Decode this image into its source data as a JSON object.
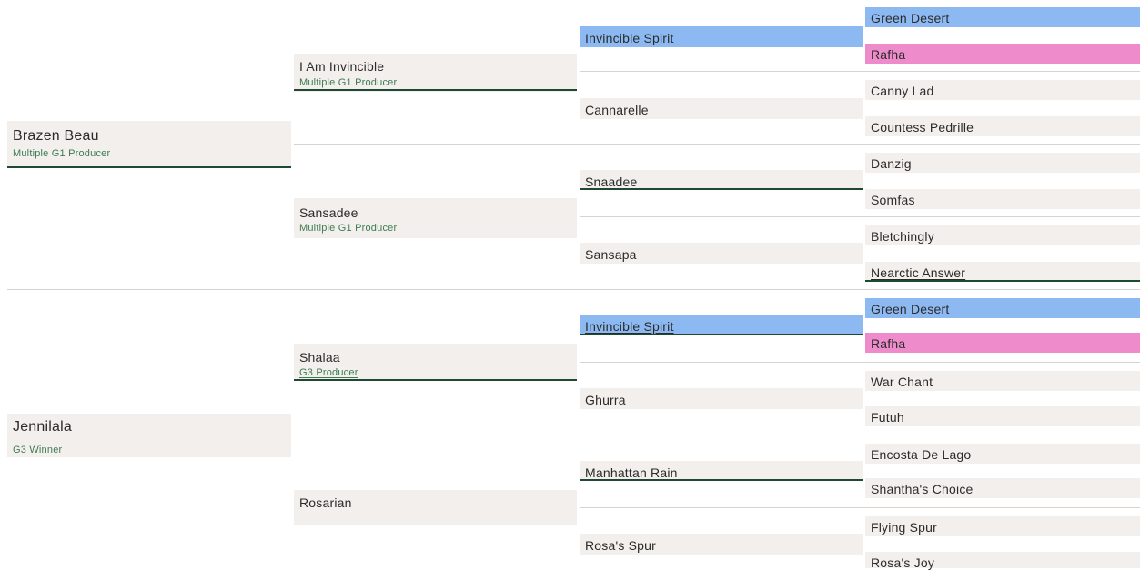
{
  "generation1": [
    {
      "name": "Brazen Beau",
      "note": "Multiple G1 Producer"
    },
    {
      "name": "Jennilala",
      "note": "G3 Winner"
    }
  ],
  "generation2": [
    {
      "name": "I Am Invincible",
      "note": "Multiple G1 Producer"
    },
    {
      "name": "Sansadee",
      "note": "Multiple G1 Producer"
    },
    {
      "name": "Shalaa",
      "note": "G3 Producer"
    },
    {
      "name": "Rosarian",
      "note": ""
    }
  ],
  "generation3": [
    {
      "name": "Invincible Spirit"
    },
    {
      "name": "Cannarelle"
    },
    {
      "name": "Snaadee"
    },
    {
      "name": "Sansapa"
    },
    {
      "name": "Invincible Spirit"
    },
    {
      "name": "Ghurra"
    },
    {
      "name": "Manhattan Rain"
    },
    {
      "name": "Rosa's Spur"
    }
  ],
  "generation4": [
    {
      "name": "Green Desert"
    },
    {
      "name": "Rafha"
    },
    {
      "name": "Canny Lad"
    },
    {
      "name": "Countess Pedrille"
    },
    {
      "name": "Danzig"
    },
    {
      "name": "Somfas"
    },
    {
      "name": "Bletchingly"
    },
    {
      "name": "Nearctic Answer"
    },
    {
      "name": "Green Desert"
    },
    {
      "name": "Rafha"
    },
    {
      "name": "War Chant"
    },
    {
      "name": "Futuh"
    },
    {
      "name": "Encosta De Lago"
    },
    {
      "name": "Shantha's Choice"
    },
    {
      "name": "Flying Spur"
    },
    {
      "name": "Rosa's Joy"
    }
  ],
  "colors": {
    "cell_bg": "#f3efec",
    "highlight_blue": "#8cb9f1",
    "highlight_pink": "#ee8ccb",
    "note_green": "#3c7c52",
    "underline_dark_green": "#1f4a31"
  }
}
